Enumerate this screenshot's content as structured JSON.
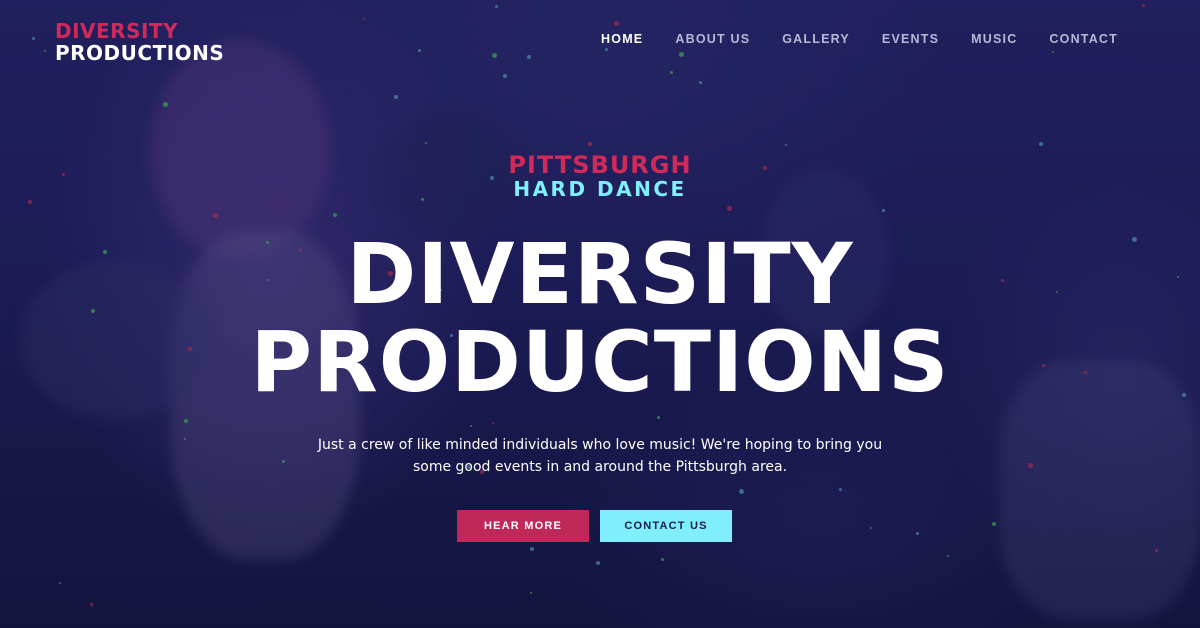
{
  "brand": {
    "logo_line1": "DIVERSITY",
    "logo_line2": "PRODUCTIONS",
    "accent_color": "#d02a5a",
    "secondary_color": "#7fefff"
  },
  "nav": {
    "items": [
      {
        "label": "HOME",
        "active": true
      },
      {
        "label": "ABOUT US",
        "active": false
      },
      {
        "label": "GALLERY",
        "active": false
      },
      {
        "label": "EVENTS",
        "active": false
      },
      {
        "label": "MUSIC",
        "active": false
      },
      {
        "label": "CONTACT",
        "active": false
      }
    ]
  },
  "hero": {
    "kicker_line1": "PITTSBURGH",
    "kicker_line2": "HARD DANCE",
    "title_line1": "DIVERSITY",
    "title_line2": "PRODUCTIONS",
    "tagline_line1": "Just a crew of like minded individuals who love music! We're hoping to bring you",
    "tagline_line2": "some good events in and around the Pittsburgh area.",
    "primary_button": "HEAR MORE",
    "secondary_button": "CONTACT US"
  }
}
